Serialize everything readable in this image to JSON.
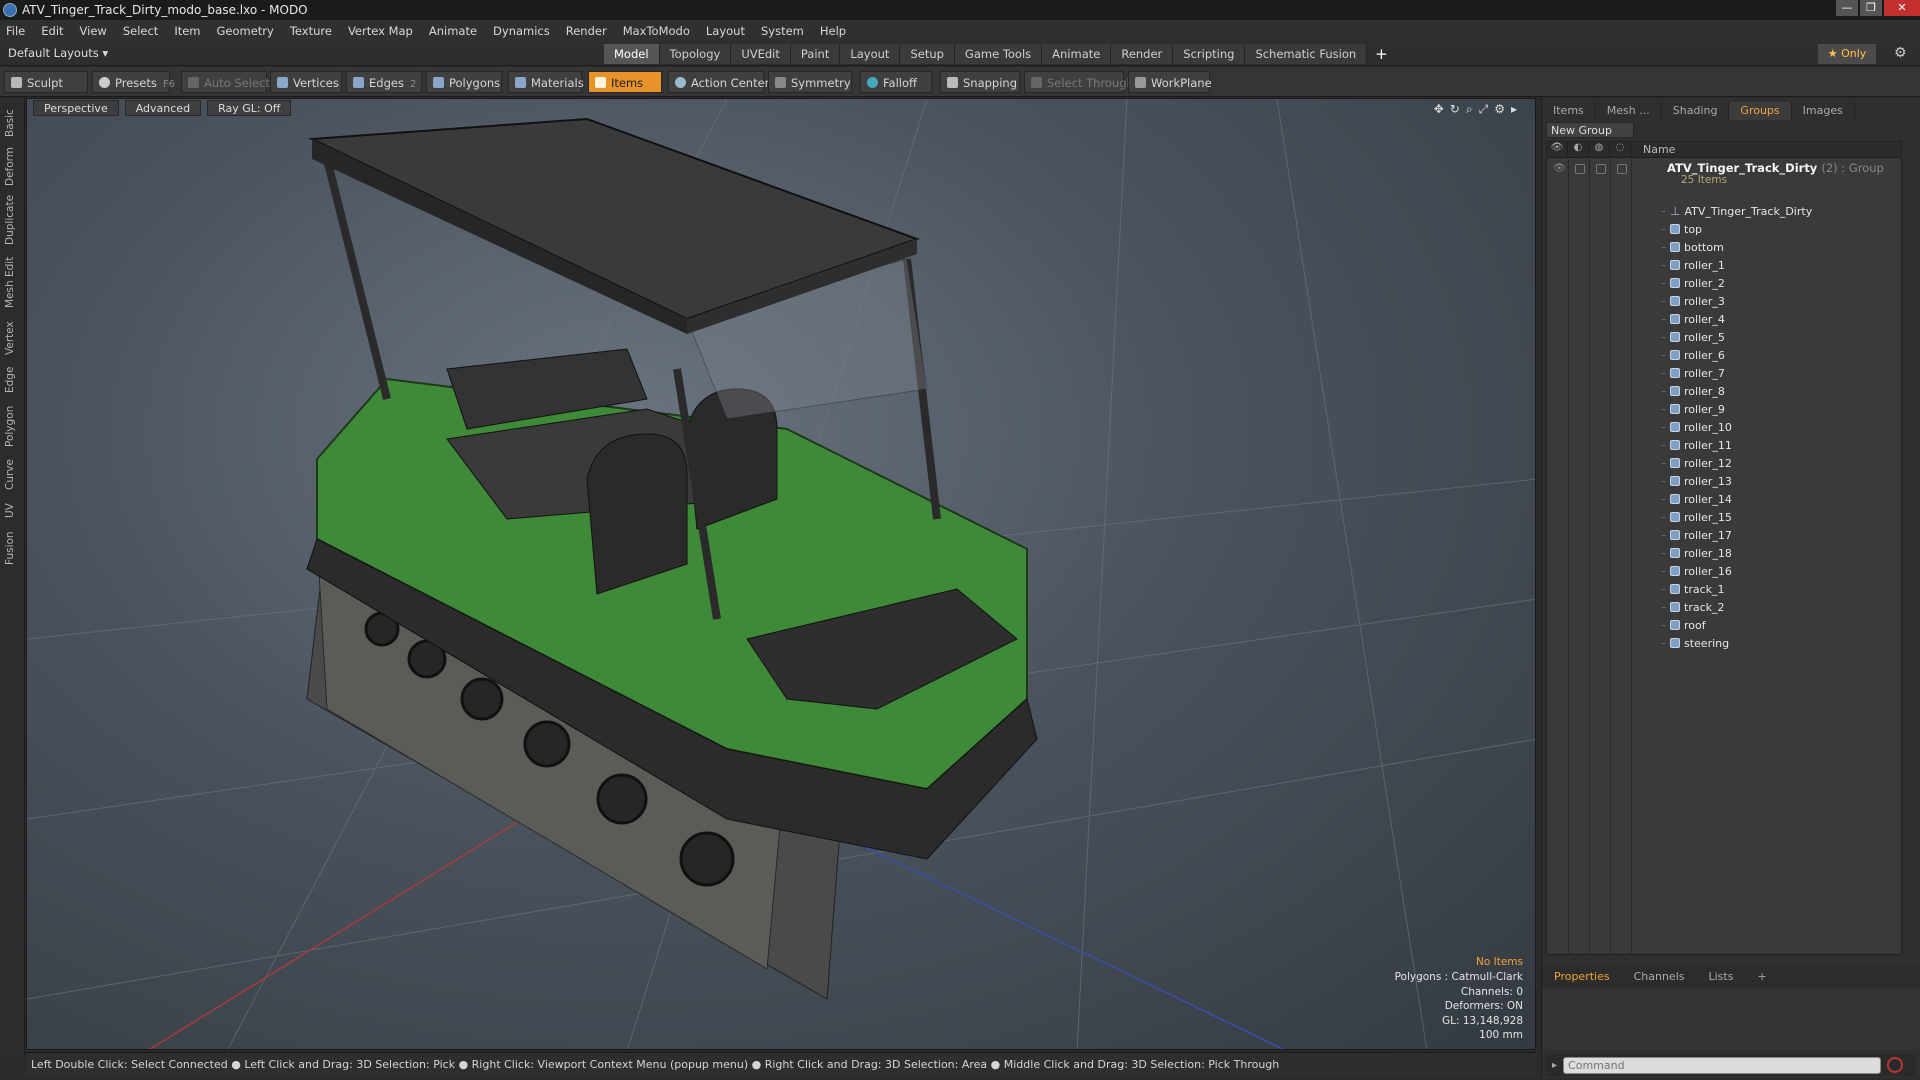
{
  "window": {
    "title": "ATV_Tinger_Track_Dirty_modo_base.lxo - MODO",
    "minimize": "—",
    "maximize": "❐",
    "close": "✕"
  },
  "menu": [
    "File",
    "Edit",
    "View",
    "Select",
    "Item",
    "Geometry",
    "Texture",
    "Vertex Map",
    "Animate",
    "Dynamics",
    "Render",
    "MaxToModo",
    "Layout",
    "System",
    "Help"
  ],
  "layouts": {
    "current": "Default Layouts ▾",
    "tabs": [
      "Model",
      "Topology",
      "UVEdit",
      "Paint",
      "Layout",
      "Setup",
      "Game Tools",
      "Animate",
      "Render",
      "Scripting",
      "Schematic Fusion"
    ],
    "active": "Model",
    "add": "+",
    "only": "★ Only"
  },
  "toolbar": {
    "sculpt": "Sculpt",
    "presets": "Presets",
    "presets_key": "F6",
    "auto_select": "Auto Select",
    "vertices": "Vertices",
    "vertices_key": "1",
    "edges": "Edges",
    "edges_key": "2",
    "polygons": "Polygons",
    "materials": "Materials",
    "items": "Items",
    "action_center": "Action Center",
    "symmetry": "Symmetry",
    "falloff": "Falloff",
    "snapping": "Snapping",
    "select_through": "Select Through",
    "workplane": "WorkPlane"
  },
  "left_tabs": [
    "Basic",
    "Deform",
    "Duplicate",
    "Mesh Edit",
    "Vertex",
    "Edge",
    "Polygon",
    "Curve",
    "UV",
    "Fusion"
  ],
  "viewport": {
    "view": "Perspective",
    "shading": "Advanced",
    "raygl": "Ray GL: Off",
    "info": {
      "no_items": "No Items",
      "polygons": "Polygons : Catmull-Clark",
      "channels": "Channels: 0",
      "deformers": "Deformers: ON",
      "gl": "GL: 13,148,928",
      "scale": "100 mm"
    }
  },
  "status": "Left Double Click: Select Connected ● Left Click and Drag: 3D Selection: Pick ● Right Click: Viewport Context Menu (popup menu) ● Right Click and Drag: 3D Selection: Area ● Middle Click and Drag: 3D Selection: Pick Through",
  "right_panel": {
    "tabs": [
      "Items",
      "Mesh ...",
      "Shading",
      "Groups",
      "Images"
    ],
    "active_tab": "Groups",
    "new_group": "New Group",
    "column_name": "Name",
    "group": {
      "name": "ATV_Tinger_Track_Dirty",
      "count": "(2) : Group",
      "subtitle": "25 Items"
    },
    "items": [
      {
        "name": "ATV_Tinger_Track_Dirty",
        "type": "locator"
      },
      {
        "name": "top",
        "type": "mesh"
      },
      {
        "name": "bottom",
        "type": "mesh"
      },
      {
        "name": "roller_1",
        "type": "mesh"
      },
      {
        "name": "roller_2",
        "type": "mesh"
      },
      {
        "name": "roller_3",
        "type": "mesh"
      },
      {
        "name": "roller_4",
        "type": "mesh"
      },
      {
        "name": "roller_5",
        "type": "mesh"
      },
      {
        "name": "roller_6",
        "type": "mesh"
      },
      {
        "name": "roller_7",
        "type": "mesh"
      },
      {
        "name": "roller_8",
        "type": "mesh"
      },
      {
        "name": "roller_9",
        "type": "mesh"
      },
      {
        "name": "roller_10",
        "type": "mesh"
      },
      {
        "name": "roller_11",
        "type": "mesh"
      },
      {
        "name": "roller_12",
        "type": "mesh"
      },
      {
        "name": "roller_13",
        "type": "mesh"
      },
      {
        "name": "roller_14",
        "type": "mesh"
      },
      {
        "name": "roller_15",
        "type": "mesh"
      },
      {
        "name": "roller_17",
        "type": "mesh"
      },
      {
        "name": "roller_18",
        "type": "mesh"
      },
      {
        "name": "roller_16",
        "type": "mesh"
      },
      {
        "name": "track_1",
        "type": "mesh"
      },
      {
        "name": "track_2",
        "type": "mesh"
      },
      {
        "name": "roof",
        "type": "mesh"
      },
      {
        "name": "steering",
        "type": "mesh"
      }
    ],
    "bottom_tabs": [
      "Properties",
      "Channels",
      "Lists",
      "+"
    ],
    "bottom_active": "Properties",
    "command_placeholder": "Command"
  },
  "colors": {
    "accent": "#e8922a",
    "active_tab_text": "#f2a23a",
    "vehicle_body": "#3f8a38"
  }
}
